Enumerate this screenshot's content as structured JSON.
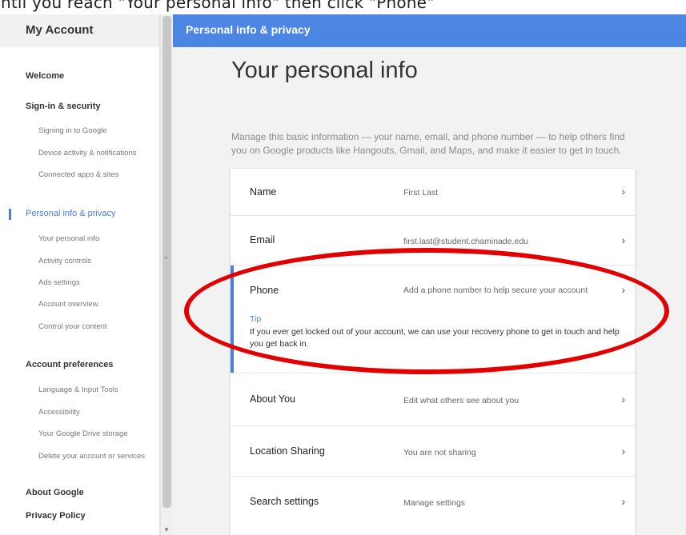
{
  "caption": "ntil you reach \"Your personal info\" then click \"Phone\"",
  "sidebar": {
    "title": "My Account",
    "items": [
      {
        "label": "Welcome",
        "kind": "section"
      },
      {
        "label": "Sign-in & security",
        "kind": "section"
      },
      {
        "label": "Signing in to Google",
        "kind": "sub"
      },
      {
        "label": "Device activity & notifications",
        "kind": "sub"
      },
      {
        "label": "Connected apps & sites",
        "kind": "sub"
      },
      {
        "label": "Personal info & privacy",
        "kind": "active"
      },
      {
        "label": "Your personal info",
        "kind": "sub"
      },
      {
        "label": "Activity controls",
        "kind": "sub"
      },
      {
        "label": "Ads settings",
        "kind": "sub"
      },
      {
        "label": "Account overview",
        "kind": "sub"
      },
      {
        "label": "Control your content",
        "kind": "sub"
      },
      {
        "label": "Account preferences",
        "kind": "section"
      },
      {
        "label": "Language & Input Tools",
        "kind": "sub"
      },
      {
        "label": "Accessibility",
        "kind": "sub"
      },
      {
        "label": "Your Google Drive storage",
        "kind": "sub"
      },
      {
        "label": "Delete your account or services",
        "kind": "sub"
      },
      {
        "label": "About Google",
        "kind": "section"
      },
      {
        "label": "Privacy Policy",
        "kind": "section"
      }
    ]
  },
  "topbar": {
    "title": "Personal info & privacy"
  },
  "main": {
    "title": "Your personal info",
    "intro": "Manage this basic information — your name, email, and phone number — to help others find you on Google products like Hangouts, Gmail, and Maps, and make it easier to get in touch.",
    "rows": [
      {
        "label": "Name",
        "value": "First Last"
      },
      {
        "label": "Email",
        "value": "first.last@student.chaminade.edu"
      },
      {
        "label": "Phone",
        "value": "Add a phone number to help secure your account",
        "tip_title": "Tip",
        "tip_text": "If you ever get locked out of your account, we can use your recovery phone to get in touch and help you get back in."
      },
      {
        "label": "About You",
        "value": "Edit what others see about you"
      },
      {
        "label": "Location Sharing",
        "value": "You are not sharing"
      },
      {
        "label": "Search settings",
        "value": "Manage settings"
      }
    ],
    "chevron": "›"
  },
  "colors": {
    "accent": "#4b86e2",
    "annotation": "#e20000"
  }
}
